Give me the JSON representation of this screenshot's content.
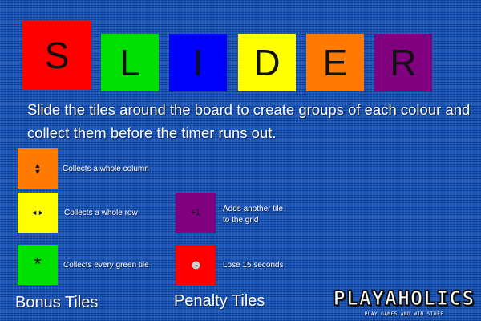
{
  "title": {
    "letters": [
      {
        "char": "S",
        "color": "#ff0000"
      },
      {
        "char": "L",
        "color": "#00e000"
      },
      {
        "char": "I",
        "color": "#0000ff"
      },
      {
        "char": "D",
        "color": "#ffff00"
      },
      {
        "char": "E",
        "color": "#ff7a00"
      },
      {
        "char": "R",
        "color": "#800080"
      }
    ]
  },
  "instructions": "Slide the tiles around the board to create groups of each colour and collect them before the timer runs out.",
  "bonus": {
    "heading": "Bonus Tiles",
    "tiles": [
      {
        "symbol_up": "▲",
        "symbol_down": "▼",
        "icon": "up-down-arrows-icon",
        "color": "#ff7a00",
        "description": "Collects a whole column"
      },
      {
        "symbol": "◄►",
        "icon": "left-right-arrows-icon",
        "color": "#ffff00",
        "description": "Collects a whole row"
      },
      {
        "symbol": "*",
        "icon": "asterisk-icon",
        "color": "#00e000",
        "description": "Collects every green tile"
      }
    ]
  },
  "penalty": {
    "heading": "Penalty Tiles",
    "tiles": [
      {
        "symbol": "+1",
        "color": "#800080",
        "description_line1": "Adds another tile",
        "description_line2": "to the grid"
      },
      {
        "icon": "clock-icon",
        "color": "#ff0000",
        "description": "Lose 15 seconds"
      }
    ]
  },
  "logo": {
    "name": "PLAYAHOLICS",
    "tagline": "PLAY GAMES AND WIN STUFF"
  }
}
